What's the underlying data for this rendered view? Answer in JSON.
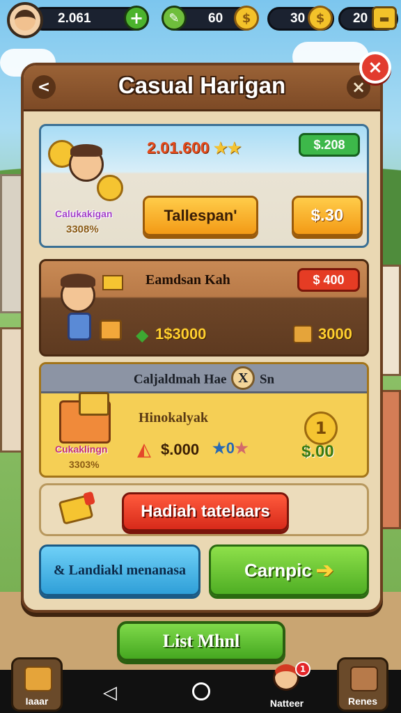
{
  "hud": {
    "coins": "2.061",
    "energy": "60",
    "gold": "30",
    "chests": "20",
    "plus_label": "+"
  },
  "panel": {
    "title": "Casual Harigan",
    "back_label": "<",
    "x_label": "×",
    "close_label": "×"
  },
  "card1": {
    "price": "2.01.600",
    "badge": "$.208",
    "label_a": "Calukakigan",
    "label_b": "3308%",
    "btn_main": "Tallespan'",
    "btn_price": "$.30"
  },
  "card2": {
    "title": "Eamdsan Kah",
    "badge": "$ 400",
    "value_1": "1$3000",
    "value_2": "3000"
  },
  "card3": {
    "strip_left": "Caljaldmah Hae",
    "strip_coin": "X",
    "strip_right": "Sn",
    "title": "Hinokalyak",
    "value": "$.000",
    "stars_text": "0",
    "coin_label": "1",
    "value_2": "$.00",
    "label_a": "Cukaklingn",
    "label_b": "3303%"
  },
  "gift": {
    "button": "Hadiah tatelaars"
  },
  "bottom": {
    "blue_button": "& Landiakl menanasa",
    "green_button": "Carnpic",
    "list_button": "List Mhnl"
  },
  "nav": {
    "left_label": "Iaaar",
    "notif_label": "Natteer",
    "notif_count": "1",
    "right_label": "Renes"
  }
}
